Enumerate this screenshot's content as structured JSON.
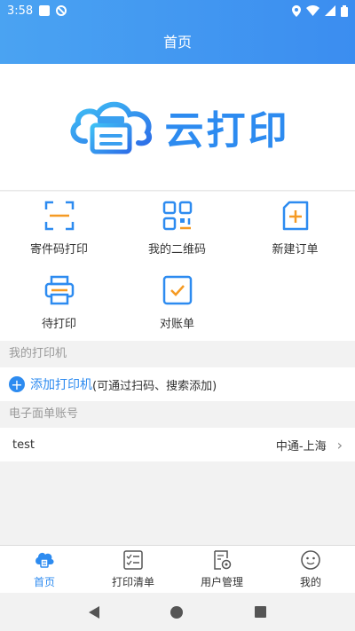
{
  "status_bar": {
    "time": "3:58"
  },
  "header": {
    "title": "首页"
  },
  "logo": {
    "text": "云打印"
  },
  "grid": {
    "items": [
      {
        "label": "寄件码打印",
        "icon": "scan-icon"
      },
      {
        "label": "我的二维码",
        "icon": "qrcode-icon"
      },
      {
        "label": "新建订单",
        "icon": "new-order-icon"
      },
      {
        "label": "待打印",
        "icon": "printer-icon"
      },
      {
        "label": "对账单",
        "icon": "statement-icon"
      }
    ]
  },
  "printers": {
    "section_title": "我的打印机",
    "add_label": "添加打印机",
    "add_hint": "(可通过扫码、搜索添加)"
  },
  "accounts": {
    "section_title": "电子面单账号",
    "rows": [
      {
        "name": "test",
        "value": "中通-上海"
      }
    ]
  },
  "tabbar": {
    "items": [
      {
        "label": "首页",
        "icon": "home-cloud-icon",
        "active": true
      },
      {
        "label": "打印清单",
        "icon": "list-icon",
        "active": false
      },
      {
        "label": "用户管理",
        "icon": "user-settings-icon",
        "active": false
      },
      {
        "label": "我的",
        "icon": "smiley-icon",
        "active": false
      }
    ]
  },
  "colors": {
    "accent": "#2d8bf0",
    "header_start": "#4aa3f2",
    "header_end": "#3b8df0"
  }
}
